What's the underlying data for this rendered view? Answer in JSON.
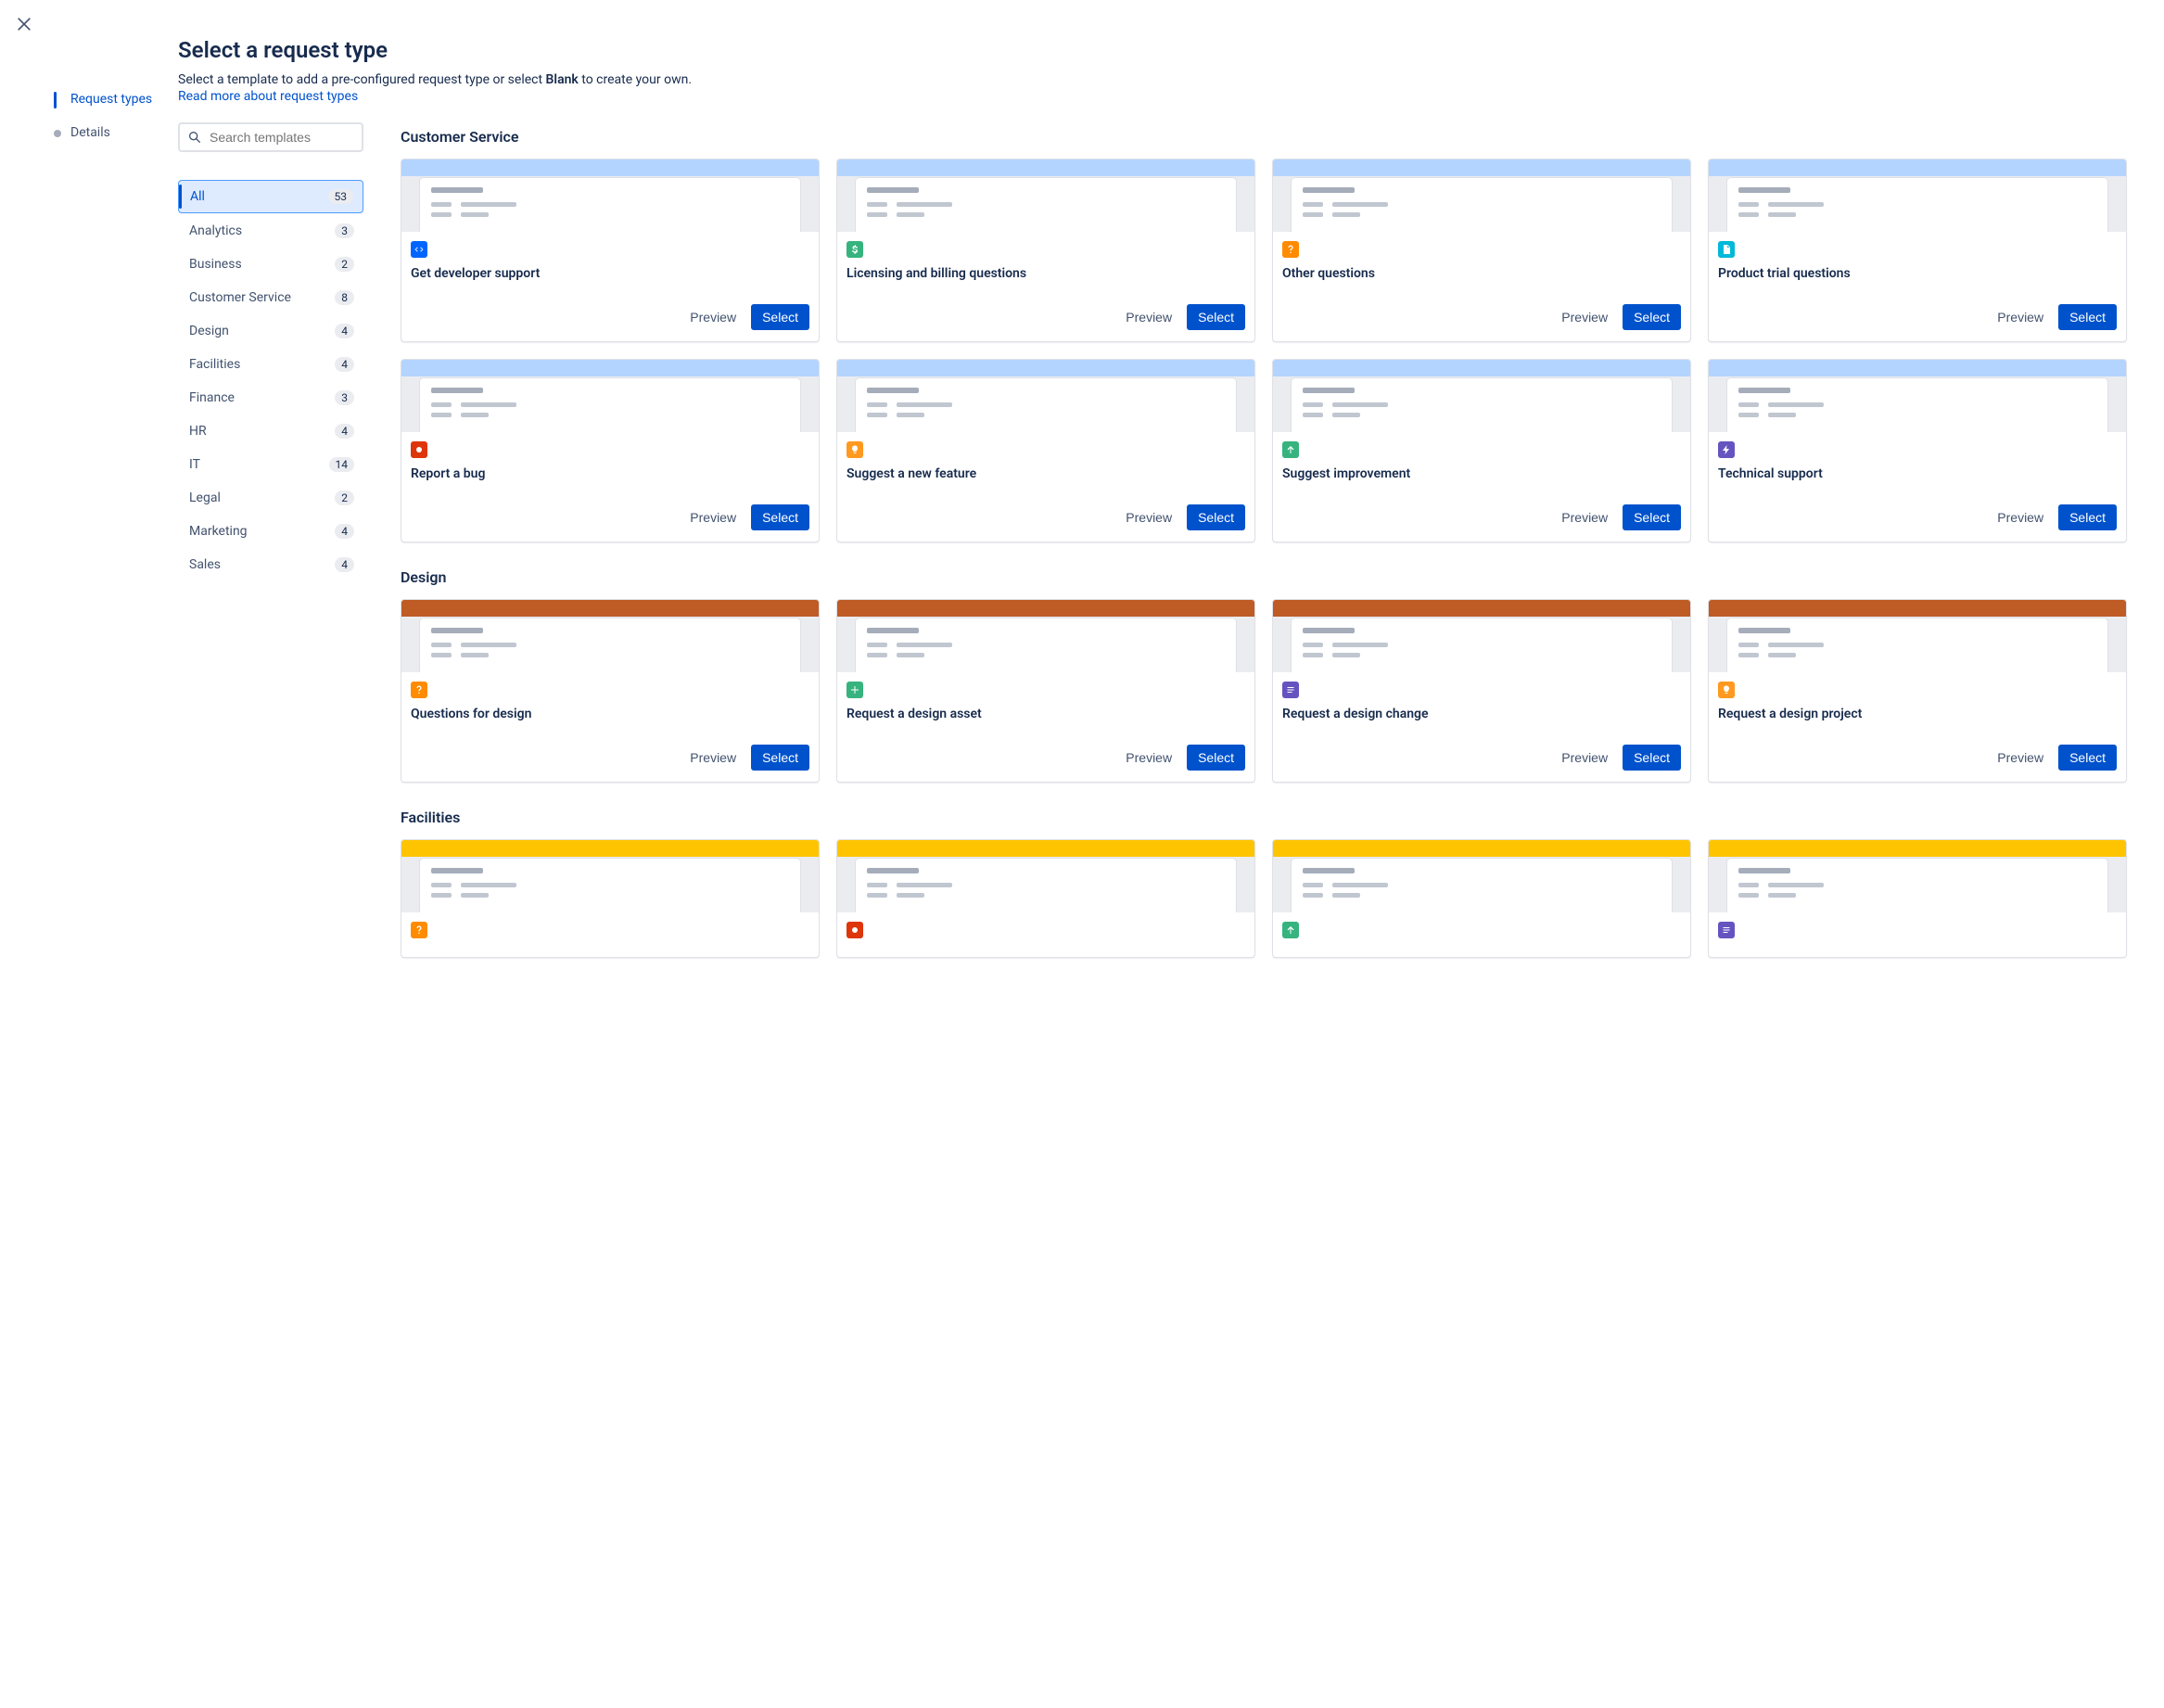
{
  "header": {
    "title": "Select a request type",
    "subtitle_pre": "Select a template to add a pre-configured request type or select ",
    "subtitle_bold": "Blank",
    "subtitle_post": " to create your own.",
    "link": "Read more about request types"
  },
  "steps": [
    {
      "label": "Request types",
      "active": true
    },
    {
      "label": "Details",
      "active": false
    }
  ],
  "search": {
    "placeholder": "Search templates"
  },
  "categories": [
    {
      "label": "All",
      "count": "53",
      "active": true
    },
    {
      "label": "Analytics",
      "count": "3"
    },
    {
      "label": "Business",
      "count": "2"
    },
    {
      "label": "Customer Service",
      "count": "8"
    },
    {
      "label": "Design",
      "count": "4"
    },
    {
      "label": "Facilities",
      "count": "4"
    },
    {
      "label": "Finance",
      "count": "3"
    },
    {
      "label": "HR",
      "count": "4"
    },
    {
      "label": "IT",
      "count": "14"
    },
    {
      "label": "Legal",
      "count": "2"
    },
    {
      "label": "Marketing",
      "count": "4"
    },
    {
      "label": "Sales",
      "count": "4"
    }
  ],
  "buttons": {
    "preview": "Preview",
    "select": "Select"
  },
  "sections": [
    {
      "title": "Customer Service",
      "band_color": "#B3D4FF",
      "cards": [
        {
          "title": "Get developer support",
          "icon": "code",
          "icon_bg": "#0065FF"
        },
        {
          "title": "Licensing and billing questions",
          "icon": "dollar",
          "icon_bg": "#36B37E"
        },
        {
          "title": "Other questions",
          "icon": "question",
          "icon_bg": "#FF8B00"
        },
        {
          "title": "Product trial questions",
          "icon": "page",
          "icon_bg": "#00B8D9"
        },
        {
          "title": "Report a bug",
          "icon": "stop",
          "icon_bg": "#DE350B"
        },
        {
          "title": "Suggest a new feature",
          "icon": "bulb",
          "icon_bg": "#FF991F"
        },
        {
          "title": "Suggest improvement",
          "icon": "arrow-up",
          "icon_bg": "#36B37E"
        },
        {
          "title": "Technical support",
          "icon": "bolt",
          "icon_bg": "#6554C0"
        }
      ]
    },
    {
      "title": "Design",
      "band_color": "#BF5B24",
      "cards": [
        {
          "title": "Questions for design",
          "icon": "question",
          "icon_bg": "#FF8B00"
        },
        {
          "title": "Request a design asset",
          "icon": "plus",
          "icon_bg": "#36B37E"
        },
        {
          "title": "Request a design change",
          "icon": "doc",
          "icon_bg": "#6554C0"
        },
        {
          "title": "Request a design project",
          "icon": "bulb",
          "icon_bg": "#FF991F"
        }
      ]
    },
    {
      "title": "Facilities",
      "band_color": "#FFC400",
      "partial": true,
      "cards": [
        {
          "title": "",
          "icon": "question",
          "icon_bg": "#FF8B00"
        },
        {
          "title": "",
          "icon": "stop",
          "icon_bg": "#DE350B"
        },
        {
          "title": "",
          "icon": "arrow-up",
          "icon_bg": "#36B37E"
        },
        {
          "title": "",
          "icon": "doc",
          "icon_bg": "#6554C0"
        }
      ]
    }
  ]
}
